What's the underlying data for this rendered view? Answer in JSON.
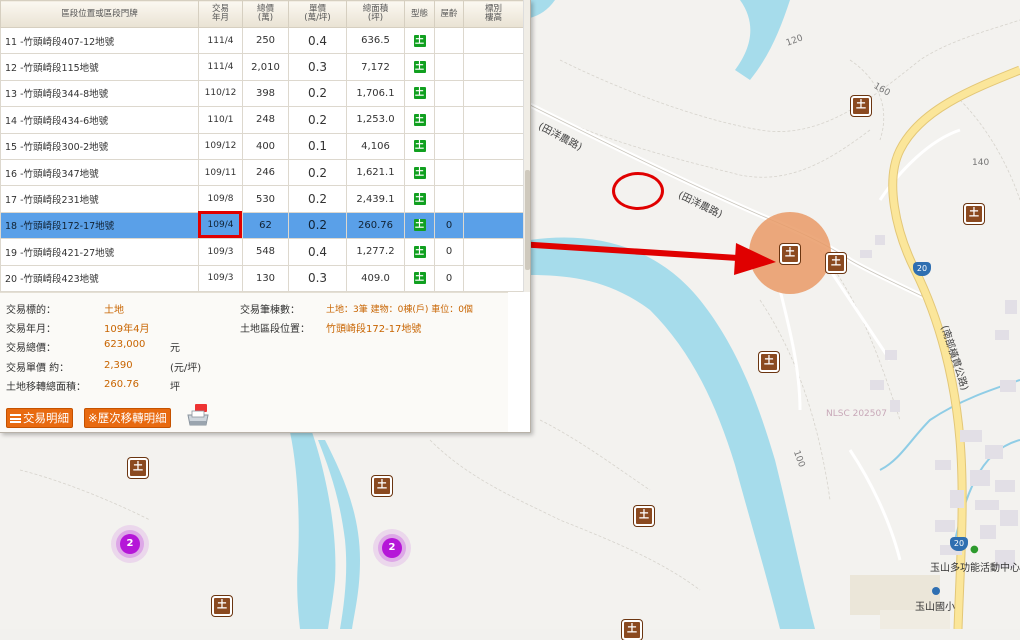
{
  "table": {
    "headers": {
      "address": "區段位置或區段門牌",
      "year_month": "交易\n年月",
      "total_price": "總價\n(萬)",
      "unit_price": "單價\n(萬/坪)",
      "area": "總面積\n(坪)",
      "type": "型態",
      "age": "屋齡",
      "floor": "標別\n樓高"
    },
    "rows": [
      {
        "address": "11 -竹頭崎段407-12地號",
        "year_month": "111/4",
        "total_price": "250",
        "unit_price": "0.4",
        "area": "636.5",
        "type": "土",
        "age": ""
      },
      {
        "address": "12 -竹頭崎段115地號",
        "year_month": "111/4",
        "total_price": "2,010",
        "unit_price": "0.3",
        "area": "7,172",
        "type": "土",
        "age": ""
      },
      {
        "address": "13 -竹頭崎段344-8地號",
        "year_month": "110/12",
        "total_price": "398",
        "unit_price": "0.2",
        "area": "1,706.1",
        "type": "土",
        "age": ""
      },
      {
        "address": "14 -竹頭崎段434-6地號",
        "year_month": "110/1",
        "total_price": "248",
        "unit_price": "0.2",
        "area": "1,253.0",
        "type": "土",
        "age": ""
      },
      {
        "address": "15 -竹頭崎段300-2地號",
        "year_month": "109/12",
        "total_price": "400",
        "unit_price": "0.1",
        "area": "4,106",
        "type": "土",
        "age": ""
      },
      {
        "address": "16 -竹頭崎段347地號",
        "year_month": "109/11",
        "total_price": "246",
        "unit_price": "0.2",
        "area": "1,621.1",
        "type": "土",
        "age": ""
      },
      {
        "address": "17 -竹頭崎段231地號",
        "year_month": "109/8",
        "total_price": "530",
        "unit_price": "0.2",
        "area": "2,439.1",
        "type": "土",
        "age": ""
      },
      {
        "address": "18 -竹頭崎段172-17地號",
        "year_month": "109/4",
        "total_price": "62",
        "unit_price": "0.2",
        "area": "260.76",
        "type": "土",
        "age": "0"
      },
      {
        "address": "19 -竹頭崎段421-27地號",
        "year_month": "109/3",
        "total_price": "548",
        "unit_price": "0.4",
        "area": "1,277.2",
        "type": "土",
        "age": "0"
      },
      {
        "address": "20 -竹頭崎段423地號",
        "year_month": "109/3",
        "total_price": "130",
        "unit_price": "0.3",
        "area": "409.0",
        "type": "土",
        "age": "0"
      }
    ]
  },
  "detail": {
    "target_label": "交易標的：",
    "target_value": "土地",
    "ym_label": "交易年月：",
    "ym_value": "109年4月",
    "total_label": "交易總價：",
    "total_value": "623,000",
    "total_unit": "元",
    "unit_label": "交易單價 約：",
    "unit_value": "2,390",
    "unit_unit": "(元/坪)",
    "area_label": "土地移轉總面積：",
    "area_value": "260.76",
    "area_unit": "坪",
    "count_label": "交易筆棟數：",
    "count_value": "土地：3筆 建物：0棟(戶) 車位：0個",
    "location_label": "土地區段位置：",
    "location_value": "竹頭崎段172-17地號"
  },
  "buttons": {
    "detail": "交易明細",
    "history": "※歷次移轉明細"
  },
  "map": {
    "road_label_1": "(田洋農路)",
    "road_label_2": "(田洋農路)",
    "highway_label": "(南部橫貫公路)",
    "route_shield": "20",
    "route_shield_2": "20",
    "contour_120": "120",
    "contour_160": "160",
    "contour_140": "140",
    "contour_100": "100",
    "watermark": "NLSC 202507",
    "poi_activity": "玉山多功能活動中心",
    "poi_school": "玉山國小",
    "cluster_1": "2",
    "cluster_2": "2",
    "marker_glyph": "土"
  },
  "colors": {
    "land_badge": "#11a020",
    "selected_row": "#5aa0e8",
    "highlight": "#e00000",
    "marker": "#8b4a20",
    "button": "#e86a10",
    "river": "#a6dceb",
    "highway": "#fbe69a",
    "cluster": "#b516d8"
  }
}
